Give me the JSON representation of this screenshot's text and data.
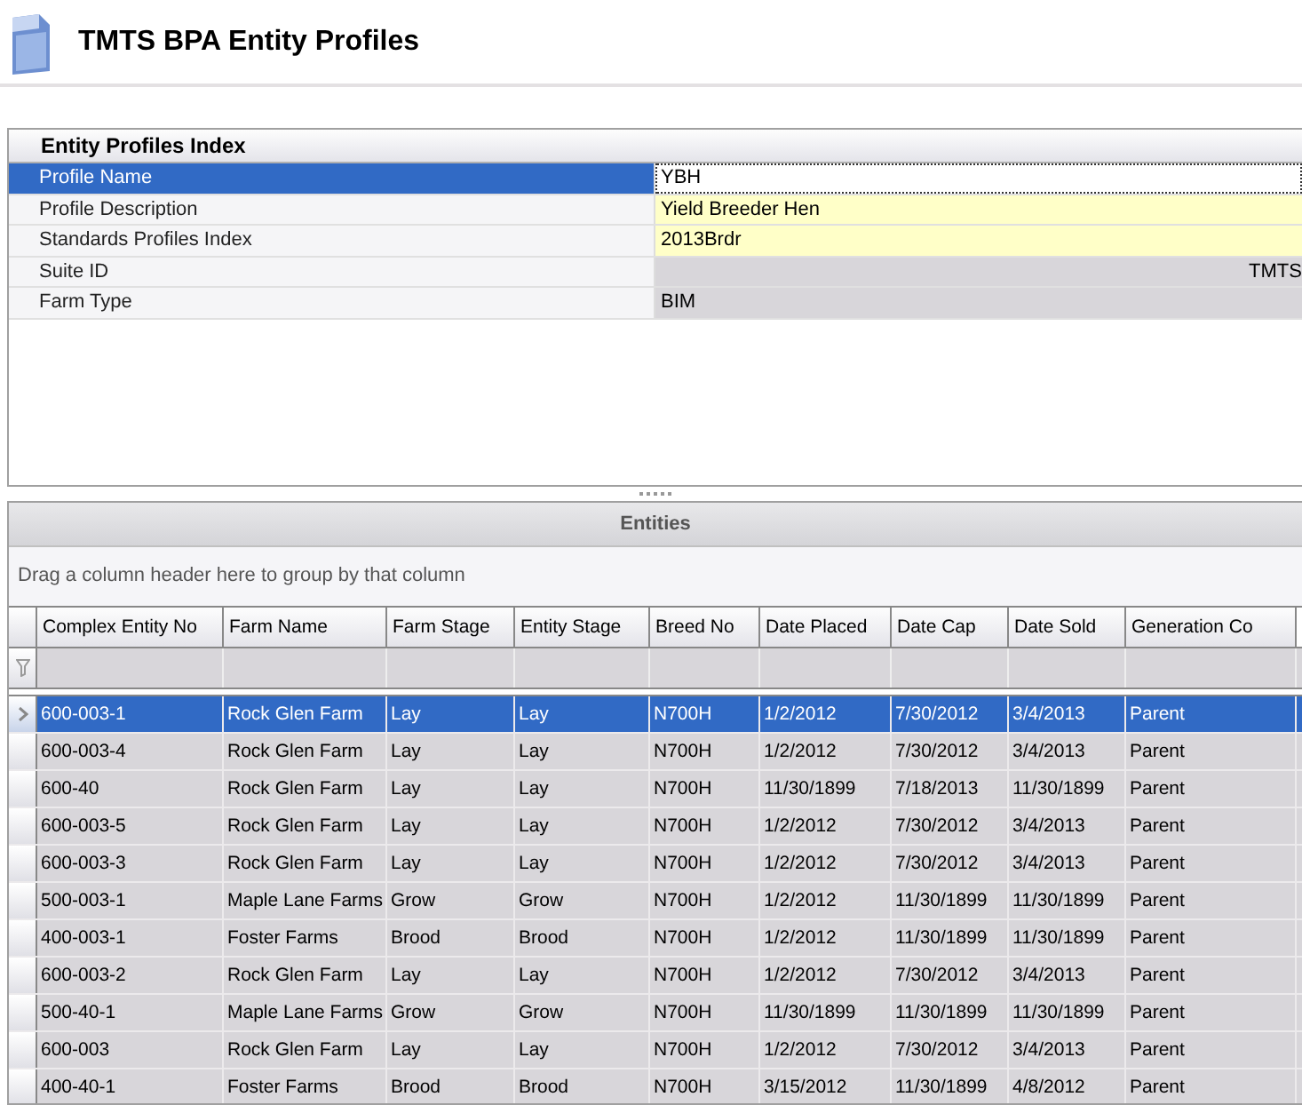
{
  "window": {
    "title": "TMTS BPA Entity Profiles"
  },
  "profile_panel": {
    "title": "Entity Profiles Index",
    "fields": [
      {
        "label": "Profile Name",
        "value": "YBH",
        "kind": "editable",
        "selected": true
      },
      {
        "label": "Profile Description",
        "value": "Yield Breeder Hen",
        "kind": "editable",
        "selected": false
      },
      {
        "label": "Standards Profiles Index",
        "value": "2013Brdr",
        "kind": "editable",
        "selected": false
      },
      {
        "label": "Suite ID",
        "value": "TMTS",
        "kind": "readonly_right",
        "selected": false
      },
      {
        "label": "Farm Type",
        "value": "BIM",
        "kind": "readonly",
        "selected": false
      }
    ]
  },
  "entities": {
    "title": "Entities",
    "group_hint": "Drag a column header here to group by that column",
    "columns": [
      "Complex Entity No",
      "Farm Name",
      "Farm Stage",
      "Entity Stage",
      "Breed No",
      "Date Placed",
      "Date Cap",
      "Date Sold",
      "Generation Co"
    ],
    "rows": [
      {
        "cells": [
          "600-003-1",
          "Rock Glen Farm",
          "Lay",
          "Lay",
          "N700H",
          "1/2/2012",
          "7/30/2012",
          "3/4/2013",
          "Parent"
        ],
        "selected": true
      },
      {
        "cells": [
          "600-003-4",
          "Rock Glen Farm",
          "Lay",
          "Lay",
          "N700H",
          "1/2/2012",
          "7/30/2012",
          "3/4/2013",
          "Parent"
        ],
        "selected": false
      },
      {
        "cells": [
          "600-40",
          "Rock Glen Farm",
          "Lay",
          "Lay",
          "N700H",
          "11/30/1899",
          "7/18/2013",
          "11/30/1899",
          "Parent"
        ],
        "selected": false
      },
      {
        "cells": [
          "600-003-5",
          "Rock Glen Farm",
          "Lay",
          "Lay",
          "N700H",
          "1/2/2012",
          "7/30/2012",
          "3/4/2013",
          "Parent"
        ],
        "selected": false
      },
      {
        "cells": [
          "600-003-3",
          "Rock Glen Farm",
          "Lay",
          "Lay",
          "N700H",
          "1/2/2012",
          "7/30/2012",
          "3/4/2013",
          "Parent"
        ],
        "selected": false
      },
      {
        "cells": [
          "500-003-1",
          "Maple Lane Farms",
          "Grow",
          "Grow",
          "N700H",
          "1/2/2012",
          "11/30/1899",
          "11/30/1899",
          "Parent"
        ],
        "selected": false
      },
      {
        "cells": [
          "400-003-1",
          "Foster Farms",
          "Brood",
          "Brood",
          "N700H",
          "1/2/2012",
          "11/30/1899",
          "11/30/1899",
          "Parent"
        ],
        "selected": false
      },
      {
        "cells": [
          "600-003-2",
          "Rock Glen Farm",
          "Lay",
          "Lay",
          "N700H",
          "1/2/2012",
          "7/30/2012",
          "3/4/2013",
          "Parent"
        ],
        "selected": false
      },
      {
        "cells": [
          "500-40-1",
          "Maple Lane Farms",
          "Grow",
          "Grow",
          "N700H",
          "11/30/1899",
          "11/30/1899",
          "11/30/1899",
          "Parent"
        ],
        "selected": false
      },
      {
        "cells": [
          "600-003",
          "Rock Glen Farm",
          "Lay",
          "Lay",
          "N700H",
          "1/2/2012",
          "7/30/2012",
          "3/4/2013",
          "Parent"
        ],
        "selected": false
      },
      {
        "cells": [
          "400-40-1",
          "Foster Farms",
          "Brood",
          "Brood",
          "N700H",
          "3/15/2012",
          "11/30/1899",
          "4/8/2012",
          "Parent"
        ],
        "selected": false
      }
    ]
  }
}
